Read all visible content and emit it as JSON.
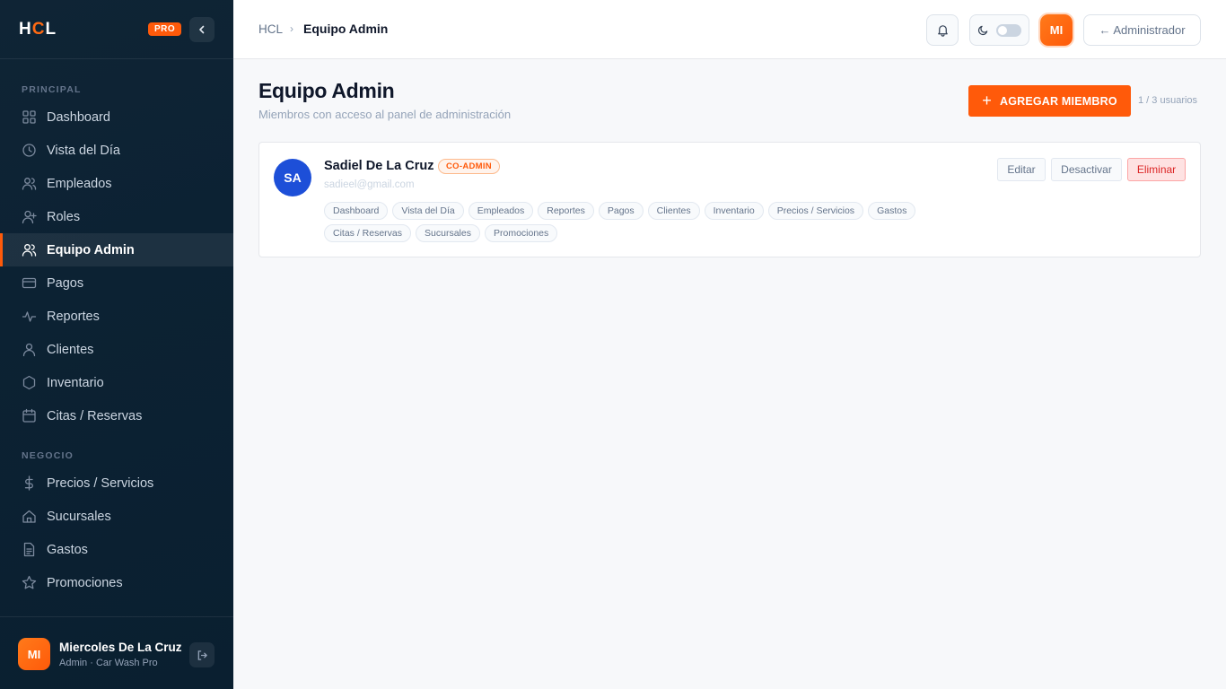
{
  "sidebar": {
    "logo_h": "H",
    "logo_c": "C",
    "logo_l": "L",
    "pro_badge": "PRO",
    "section_principal": "PRINCIPAL",
    "section_negocio": "NEGOCIO",
    "items_principal": [
      {
        "label": "Dashboard",
        "icon": "grid-icon"
      },
      {
        "label": "Vista del Día",
        "icon": "clock-icon"
      },
      {
        "label": "Empleados",
        "icon": "users-icon"
      },
      {
        "label": "Roles",
        "icon": "user-plus-icon"
      },
      {
        "label": "Equipo Admin",
        "icon": "team-icon",
        "active": true
      },
      {
        "label": "Pagos",
        "icon": "card-icon"
      },
      {
        "label": "Reportes",
        "icon": "activity-icon"
      },
      {
        "label": "Clientes",
        "icon": "person-icon"
      },
      {
        "label": "Inventario",
        "icon": "hexagon-icon"
      },
      {
        "label": "Citas / Reservas",
        "icon": "calendar-icon"
      }
    ],
    "items_negocio": [
      {
        "label": "Precios / Servicios",
        "icon": "dollar-icon"
      },
      {
        "label": "Sucursales",
        "icon": "home-icon"
      },
      {
        "label": "Gastos",
        "icon": "file-icon"
      },
      {
        "label": "Promociones",
        "icon": "star-icon"
      }
    ],
    "user": {
      "initials": "MI",
      "name": "Miercoles De La Cruz",
      "role": "Admin · Car Wash Pro"
    }
  },
  "header": {
    "breadcrumb_root": "HCL",
    "breadcrumb_sep": "›",
    "breadcrumb_current": "Equipo Admin",
    "avatar_initials": "MI",
    "admin_button": "← Administrador"
  },
  "main": {
    "title": "Equipo Admin",
    "subtitle": "Miembros con acceso al panel de administración",
    "add_button": "AGREGAR MIEMBRO",
    "user_count": "1 / 3 usuarios",
    "members": [
      {
        "initials": "SA",
        "name": "Sadiel De La Cruz",
        "badge": "CO-ADMIN",
        "email": "sadieel@gmail.com",
        "permissions": [
          "Dashboard",
          "Vista del Día",
          "Empleados",
          "Reportes",
          "Pagos",
          "Clientes",
          "Inventario",
          "Precios / Servicios",
          "Gastos",
          "Citas / Reservas",
          "Sucursales",
          "Promociones"
        ],
        "actions": {
          "edit": "Editar",
          "deactivate": "Desactivar",
          "delete": "Eliminar"
        }
      }
    ]
  },
  "colors": {
    "accent": "#ff5a0a",
    "sidebar_bg": "#0c2233",
    "member_avatar": "#1d4fd8",
    "danger": "#dc2626"
  }
}
